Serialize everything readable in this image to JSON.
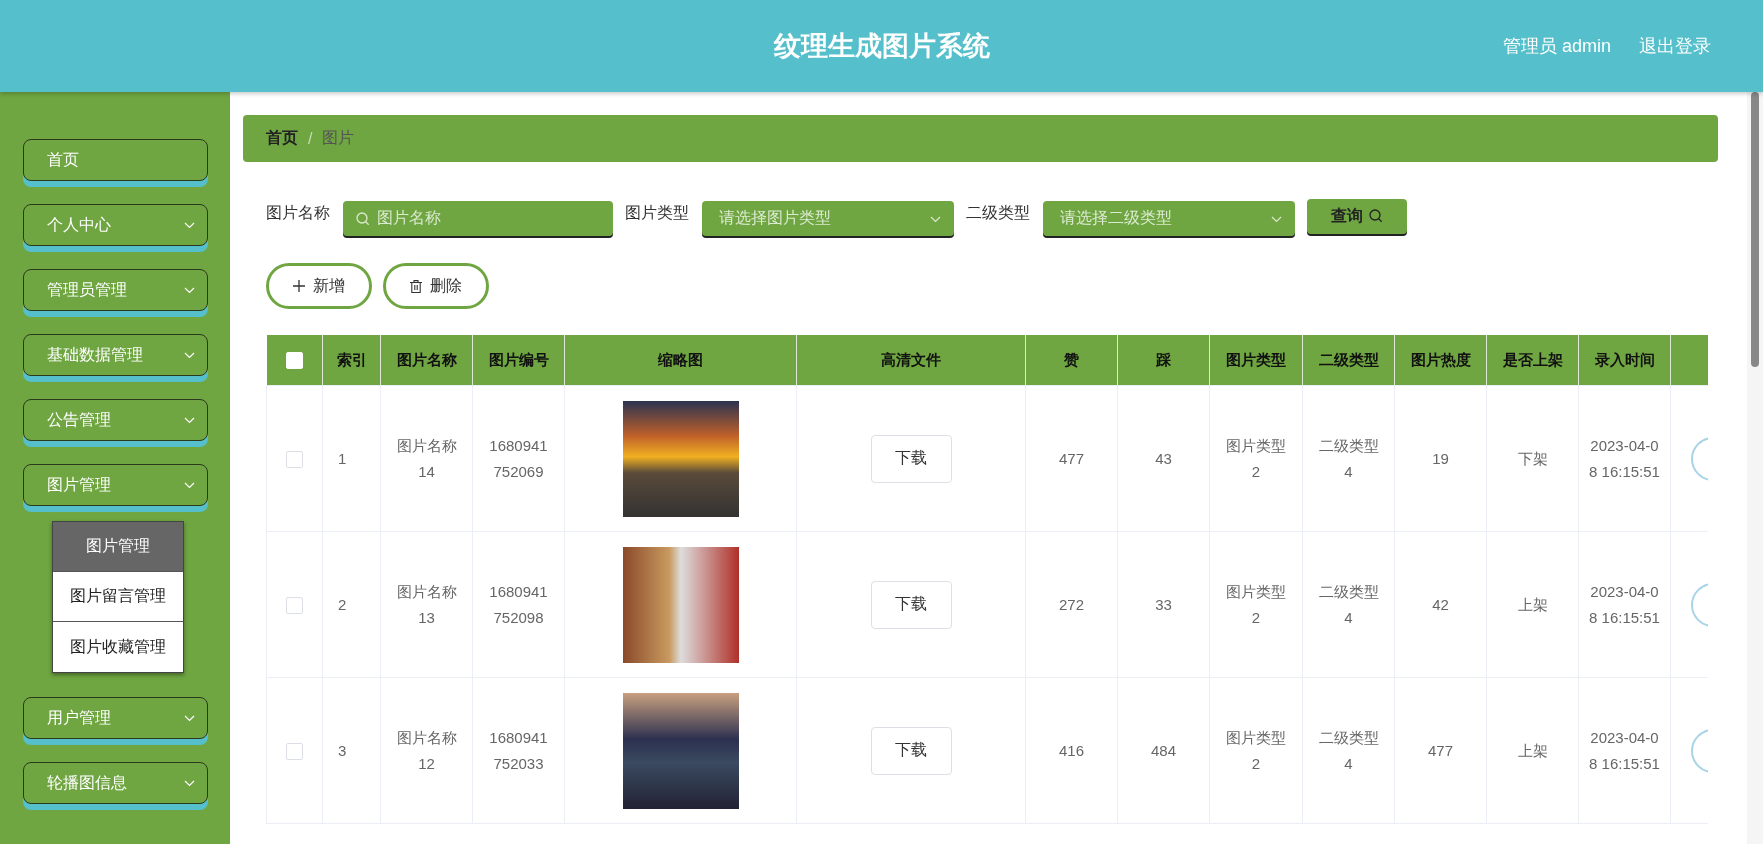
{
  "header": {
    "title": "纹理生成图片系统",
    "user": "管理员 admin",
    "logout": "退出登录"
  },
  "sidebar": {
    "items": [
      {
        "label": "首页",
        "kind": "link"
      },
      {
        "label": "个人中心",
        "kind": "menu"
      },
      {
        "label": "管理员管理",
        "kind": "menu"
      },
      {
        "label": "基础数据管理",
        "kind": "menu"
      },
      {
        "label": "公告管理",
        "kind": "menu"
      },
      {
        "label": "图片管理",
        "kind": "menu",
        "children": [
          {
            "label": "图片管理",
            "selected": true
          },
          {
            "label": "图片留言管理",
            "selected": false
          },
          {
            "label": "图片收藏管理",
            "selected": false
          }
        ]
      },
      {
        "label": "用户管理",
        "kind": "menu"
      },
      {
        "label": "轮播图信息",
        "kind": "menu"
      }
    ]
  },
  "breadcrumb": [
    "首页",
    "图片"
  ],
  "breadcrumb_separator": "/",
  "filters": [
    {
      "label": "图片名称",
      "kind": "search",
      "placeholder": "图片名称"
    },
    {
      "label": "图片类型",
      "kind": "select",
      "placeholder": "请选择图片类型"
    },
    {
      "label": "二级类型",
      "kind": "select",
      "placeholder": "请选择二级类型"
    }
  ],
  "query_button": "查询",
  "actions": [
    {
      "label": "新增",
      "kind": "add"
    },
    {
      "label": "删除",
      "kind": "delete"
    }
  ],
  "table": {
    "header_checkbox": {
      "checked": false
    },
    "columns": [
      "索引",
      "图片名称",
      "图片编号",
      "缩略图",
      "高清文件",
      "赞",
      "踩",
      "图片类型",
      "二级类型",
      "图片热度",
      "是否上架",
      "录入时间"
    ],
    "rows": [
      {
        "selected": false,
        "cells": [
          "1",
          "图片名称14",
          "1680941752069",
          null,
          "下载",
          "477",
          "43",
          "图片类型2",
          "二级类型4",
          "19",
          "下架",
          "2023-04-08 16:15:51"
        ]
      },
      {
        "selected": false,
        "cells": [
          "2",
          "图片名称13",
          "1680941752098",
          null,
          "下载",
          "272",
          "33",
          "图片类型2",
          "二级类型4",
          "42",
          "上架",
          "2023-04-08 16:15:51"
        ]
      },
      {
        "selected": false,
        "cells": [
          "3",
          "图片名称12",
          "1680941752033",
          null,
          "下载",
          "416",
          "484",
          "图片类型2",
          "二级类型4",
          "477",
          "上架",
          "2023-04-08 16:15:51"
        ]
      }
    ]
  }
}
